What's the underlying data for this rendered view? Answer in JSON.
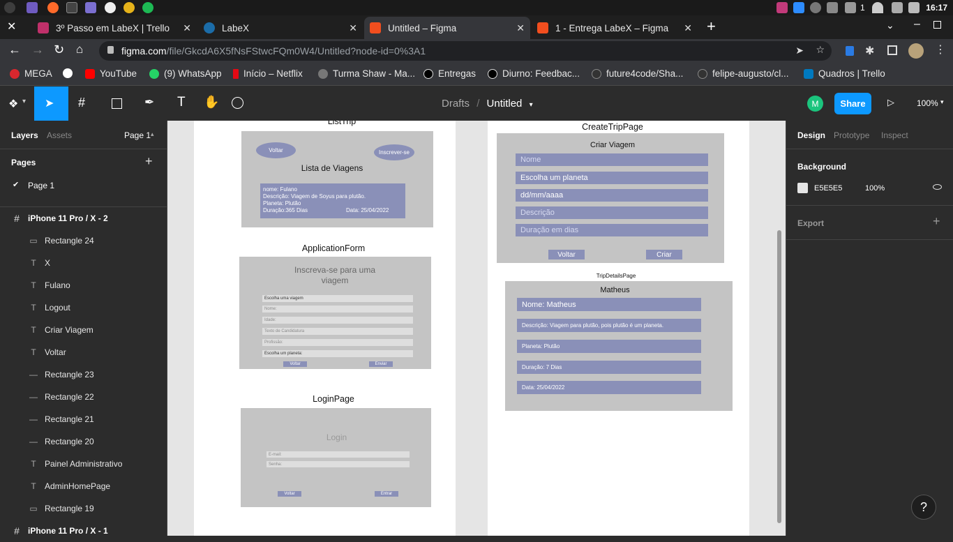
{
  "os": {
    "clock": "16:17",
    "battery": "1"
  },
  "tabs": [
    {
      "title": "3º Passo em LabeX | Trello",
      "color": "#c0306a"
    },
    {
      "title": "LabeX",
      "color": "#1b6ca8"
    },
    {
      "title": "Untitled – Figma",
      "color": "#f24e1e"
    },
    {
      "title": "1 - Entrega LabeX – Figma",
      "color": "#f24e1e"
    }
  ],
  "address": {
    "host": "figma.com",
    "path": "/file/GkcdA6X5fNsFStwcFQm0W4/Untitled?node-id=0%3A1"
  },
  "bookmarks": [
    {
      "label": "MEGA",
      "color": "#d9272e"
    },
    {
      "label": "",
      "color": "#ffffff"
    },
    {
      "label": "YouTube",
      "color": "#ff0000"
    },
    {
      "label": "(9) WhatsApp",
      "color": "#25d366"
    },
    {
      "label": "Início – Netflix",
      "color": "#e50914"
    },
    {
      "label": "Turma Shaw - Ma...",
      "color": "#777777"
    },
    {
      "label": "Entregas",
      "color": "#000000"
    },
    {
      "label": "Diurno: Feedbac...",
      "color": "#000000"
    },
    {
      "label": "future4code/Sha...",
      "color": "#333333"
    },
    {
      "label": "felipe-augusto/cl...",
      "color": "#333333"
    },
    {
      "label": "Quadros | Trello",
      "color": "#0079bf"
    }
  ],
  "toolbar": {
    "drafts": "Drafts",
    "sep": "/",
    "file": "Untitled",
    "share": "Share",
    "zoom": "100%",
    "avatar": "M"
  },
  "left": {
    "tab_layers": "Layers",
    "tab_assets": "Assets",
    "page_select": "Page 1",
    "pages_title": "Pages",
    "page_item": "Page 1",
    "layers": [
      {
        "name": "iPhone 11 Pro / X - 2",
        "kind": "frame"
      },
      {
        "name": "Rectangle 24",
        "kind": "rect"
      },
      {
        "name": "X",
        "kind": "text"
      },
      {
        "name": "Fulano",
        "kind": "text"
      },
      {
        "name": "Logout",
        "kind": "text"
      },
      {
        "name": "Criar Viagem",
        "kind": "text"
      },
      {
        "name": "Voltar",
        "kind": "text"
      },
      {
        "name": "Rectangle 23",
        "kind": "line"
      },
      {
        "name": "Rectangle 22",
        "kind": "line"
      },
      {
        "name": "Rectangle 21",
        "kind": "line"
      },
      {
        "name": "Rectangle 20",
        "kind": "line"
      },
      {
        "name": "Painel Administrativo",
        "kind": "text"
      },
      {
        "name": "AdminHomePage",
        "kind": "text"
      },
      {
        "name": "Rectangle 19",
        "kind": "rect"
      },
      {
        "name": "iPhone 11 Pro / X - 1",
        "kind": "frame"
      }
    ]
  },
  "canvas": {
    "listtrip": {
      "label": "ListTrip",
      "voltar": "Voltar",
      "inscrever": "Inscrever-se",
      "heading": "Lista de Viagens",
      "card_lines": [
        "nome: Fulano",
        "Descrição: Viagem de Soyus para plutão.",
        "Planeta: Plutão",
        "Duração:365 Dias"
      ],
      "card_date": "Data: 25/04/2022"
    },
    "appform": {
      "label": "ApplicationForm",
      "heading": "Inscreva-se para uma viagem",
      "fields": [
        "Escolha uma viagem",
        "Nome:",
        "Idade:",
        "Texto de Candidatura",
        "Profissão:",
        "Escolha um planeta:"
      ],
      "voltar": "Voltar",
      "enviar": "Enviar"
    },
    "login": {
      "label": "LoginPage",
      "heading": "Login",
      "email": "E-mail:",
      "senha": "Senha:",
      "voltar": "Voltar",
      "entrar": "Entrar"
    },
    "create": {
      "label": "CreateTripPage",
      "heading": "Criar Viagem",
      "fields": [
        "Nome",
        "Escolha um planeta",
        "dd/mm/aaaa",
        "Descrição",
        "Duração em dias"
      ],
      "voltar": "Voltar",
      "criar": "Criar"
    },
    "details": {
      "label": "TripDetailsPage",
      "heading": "Matheus",
      "rows": [
        "Nome: Matheus",
        "Descrição: Viagem para plutão, pois plutão é um planeta.",
        "Planeta: Plutão",
        "Duração: 7 Dias",
        "Data: 25/04/2022"
      ]
    }
  },
  "right": {
    "tab_design": "Design",
    "tab_prototype": "Prototype",
    "tab_inspect": "Inspect",
    "background_title": "Background",
    "bg_hex": "E5E5E5",
    "bg_opacity": "100%",
    "export_title": "Export",
    "bg_color": "#e5e5e5"
  },
  "help": "?"
}
